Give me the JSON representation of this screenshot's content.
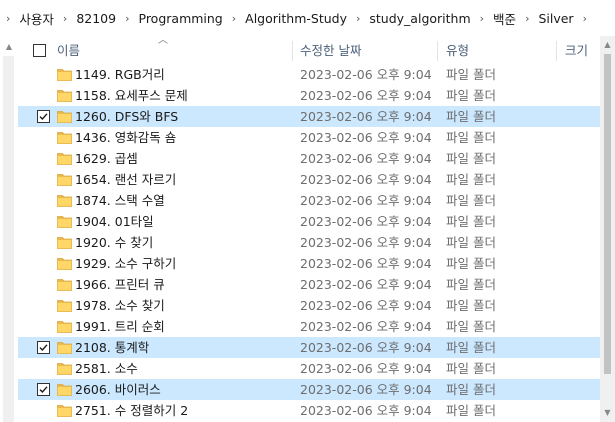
{
  "breadcrumb": [
    "사용자",
    "82109",
    "Programming",
    "Algorithm-Study",
    "study_algorithm",
    "백준",
    "Silver"
  ],
  "columns": {
    "name": "이름",
    "modified": "수정한 날짜",
    "type": "유형",
    "size": "크기"
  },
  "rows": [
    {
      "name": "1149. RGB거리",
      "date": "2023-02-06 오후 9:04",
      "type": "파일 폴더",
      "checked": false
    },
    {
      "name": "1158. 요세푸스 문제",
      "date": "2023-02-06 오후 9:04",
      "type": "파일 폴더",
      "checked": false
    },
    {
      "name": "1260. DFS와 BFS",
      "date": "2023-02-06 오후 9:04",
      "type": "파일 폴더",
      "checked": true
    },
    {
      "name": "1436. 영화감독 숌",
      "date": "2023-02-06 오후 9:04",
      "type": "파일 폴더",
      "checked": false
    },
    {
      "name": "1629. 곱셈",
      "date": "2023-02-06 오후 9:04",
      "type": "파일 폴더",
      "checked": false
    },
    {
      "name": "1654. 랜선 자르기",
      "date": "2023-02-06 오후 9:04",
      "type": "파일 폴더",
      "checked": false
    },
    {
      "name": "1874. 스택 수열",
      "date": "2023-02-06 오후 9:04",
      "type": "파일 폴더",
      "checked": false
    },
    {
      "name": "1904. 01타일",
      "date": "2023-02-06 오후 9:04",
      "type": "파일 폴더",
      "checked": false
    },
    {
      "name": "1920. 수 찾기",
      "date": "2023-02-06 오후 9:04",
      "type": "파일 폴더",
      "checked": false
    },
    {
      "name": "1929. 소수 구하기",
      "date": "2023-02-06 오후 9:04",
      "type": "파일 폴더",
      "checked": false
    },
    {
      "name": "1966. 프린터 큐",
      "date": "2023-02-06 오후 9:04",
      "type": "파일 폴더",
      "checked": false
    },
    {
      "name": "1978. 소수 찾기",
      "date": "2023-02-06 오후 9:04",
      "type": "파일 폴더",
      "checked": false
    },
    {
      "name": "1991. 트리 순회",
      "date": "2023-02-06 오후 9:04",
      "type": "파일 폴더",
      "checked": false
    },
    {
      "name": "2108. 통계학",
      "date": "2023-02-06 오후 9:04",
      "type": "파일 폴더",
      "checked": true
    },
    {
      "name": "2581. 소수",
      "date": "2023-02-06 오후 9:04",
      "type": "파일 폴더",
      "checked": false
    },
    {
      "name": "2606. 바이러스",
      "date": "2023-02-06 오후 9:04",
      "type": "파일 폴더",
      "checked": true
    },
    {
      "name": "2751. 수 정렬하기 2",
      "date": "2023-02-06 오후 9:04",
      "type": "파일 폴더",
      "checked": false
    }
  ],
  "icons": {
    "breadcrumb_separator": "chevron-right-icon",
    "folder": "folder-icon",
    "check": "checkmark-icon",
    "sort": "sort-ascending-icon"
  },
  "colors": {
    "selected_row": "#cce8ff",
    "folder_fill": "#ffd767",
    "header_text": "#4c607a"
  }
}
